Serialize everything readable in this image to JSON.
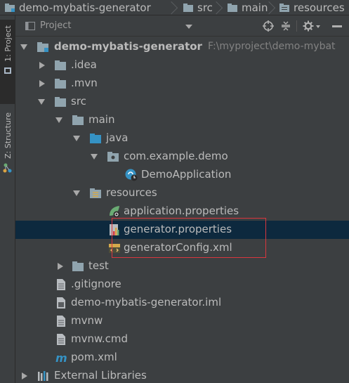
{
  "breadcrumb": {
    "items": [
      {
        "label": "demo-mybatis-generator",
        "icon": "module-folder-icon"
      },
      {
        "label": "src",
        "icon": "folder-icon"
      },
      {
        "label": "main",
        "icon": "folder-icon"
      },
      {
        "label": "resources",
        "icon": "resources-folder-icon"
      }
    ]
  },
  "toolstrip": {
    "project_tab": "1: Project",
    "structure_tab": "Z: Structure"
  },
  "panel": {
    "title": "Project",
    "icons": [
      "locate-icon",
      "collapse-all-icon",
      "gear-icon",
      "hide-icon"
    ]
  },
  "tree": {
    "root": {
      "label": "demo-mybatis-generator",
      "path": "F:\\myproject\\demo-mybat"
    },
    "idea": ".idea",
    "mvn": ".mvn",
    "src": "src",
    "main": "main",
    "java": "java",
    "package": "com.example.demo",
    "demo_app": "DemoApplication",
    "resources": "resources",
    "app_props": "application.properties",
    "gen_props": "generator.properties",
    "gen_config": "generatorConfig.xml",
    "test": "test",
    "gitignore": ".gitignore",
    "iml": "demo-mybatis-generator.iml",
    "mvnw": "mvnw",
    "mvnw_cmd": "mvnw.cmd",
    "pom": "pom.xml",
    "ext_libs": "External Libraries"
  },
  "colors": {
    "background": "#3c3f41",
    "selection": "#0d293e",
    "highlight_border": "#d9363e",
    "folder": "#90a4ae",
    "java_folder": "#3592c4",
    "spring_green": "#6aab73"
  }
}
